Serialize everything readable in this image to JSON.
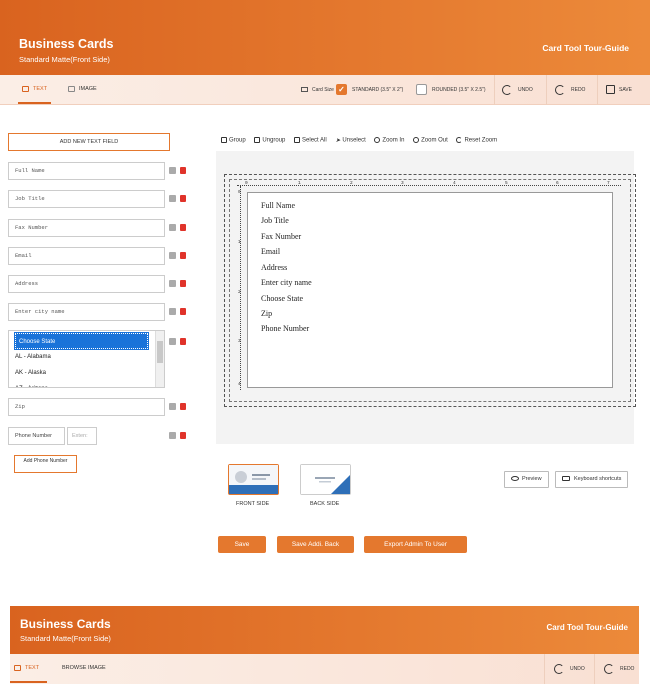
{
  "header": {
    "title": "Business Cards",
    "subtitle": "Standard Matte(Front Side)",
    "tour_guide": "Card Tool Tour-Guide"
  },
  "tabs": {
    "text": "TEXT",
    "image": "IMAGE"
  },
  "toolbar": {
    "card_size_label": "Card Size",
    "standard_label": "STANDARD (3.5\" X 2\")",
    "rounded_label": "ROUNDED (3.5\" X 2.5\")",
    "undo": "UNDO",
    "redo": "REDO",
    "save": "SAVE"
  },
  "left_panel": {
    "add_text_field": "ADD NEW TEXT FIELD",
    "fields": [
      "Full Name",
      "Job Title",
      "Fax Number",
      "Email",
      "Address",
      "Enter city name"
    ],
    "state_options": [
      "Choose State",
      "AL - Alabama",
      "AK - Alaska",
      "AZ - Arizona"
    ],
    "zip": "Zip",
    "phone_code": "Phone Number",
    "phone_ext_placeholder": "Exten:",
    "add_phone": "Add Phone Number"
  },
  "canvas_toolbar": {
    "group": "Group",
    "ungroup": "Ungroup",
    "select_all": "Select All",
    "unselect": "Unselect",
    "zoom_in": "Zoom In",
    "zoom_out": "Zoom Out",
    "reset_zoom": "Reset Zoom"
  },
  "ruler_top": [
    "0",
    "1",
    "2",
    "3",
    "4",
    "5",
    "6",
    "7"
  ],
  "ruler_left": [
    "0",
    "1",
    "2",
    "3",
    "4"
  ],
  "card_lines": [
    "Full Name",
    "Job Title",
    "Fax Number",
    "Email",
    "Address",
    "Enter city name",
    "Choose State",
    "Zip",
    "Phone Number"
  ],
  "sides": {
    "front": "FRONT SIDE",
    "back": "BACK SIDE"
  },
  "side_buttons": {
    "preview": "Preview",
    "shortcuts": "Keyboard shortcuts"
  },
  "actions": {
    "save": "Save",
    "save_back": "Save Addi. Back",
    "export": "Export Admin To User"
  },
  "footer_header": {
    "title": "Business Cards",
    "subtitle": "Standard Matte(Front Side)",
    "tour_guide": "Card Tool Tour-Guide"
  },
  "footer_toolbar": {
    "text": "TEXT",
    "browse_image": "BROWSE IMAGE",
    "undo": "UNDO",
    "redo": "REDO"
  },
  "colors": {
    "accent": "#e4782e",
    "selection": "#1a73d9",
    "delete": "#e0332a"
  }
}
